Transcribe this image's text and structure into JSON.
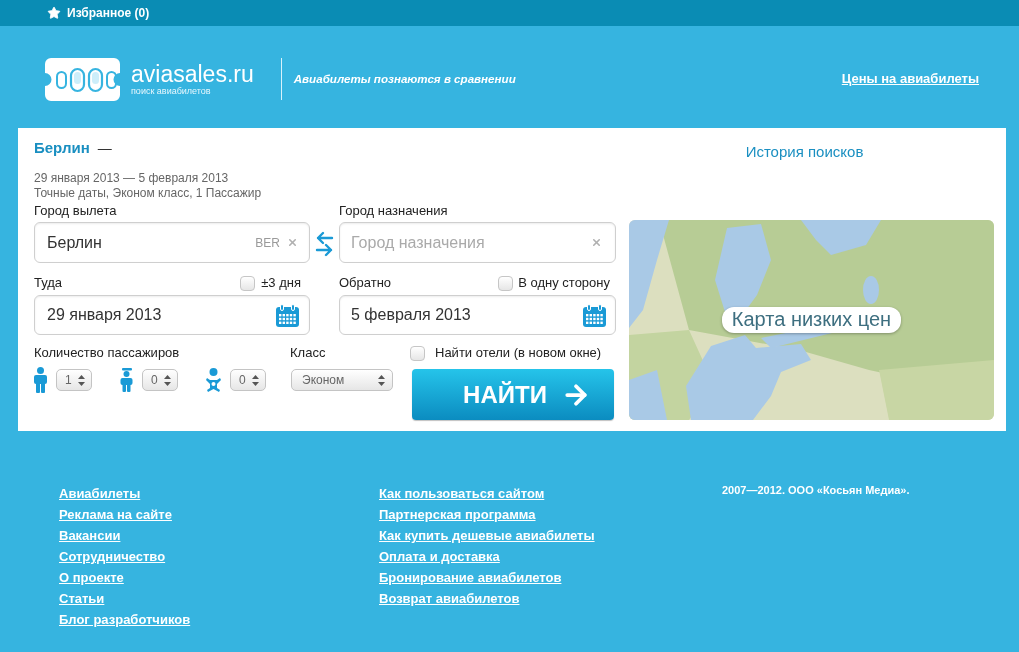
{
  "top_bar": {
    "favorites": "Избранное (0)"
  },
  "header": {
    "logo_text": "aviasales.ru",
    "logo_subtitle": "поиск авиабилетов",
    "tagline": "Авиабилеты познаются в сравнении",
    "prices_link": "Цены на авиабилеты"
  },
  "search": {
    "origin_title": "Берлин",
    "separator": "—",
    "history_link": "История поисков",
    "dates_summary": "29 января 2013 — 5 февраля 2013",
    "options_summary": "Точные даты, Эконом класс, 1 Пассажир",
    "origin_field": {
      "label": "Город вылета",
      "value": "Берлин",
      "code": "BER"
    },
    "destination_field": {
      "label": "Город назначения",
      "placeholder": "Город назначения"
    },
    "depart": {
      "label": "Туда",
      "value": "29 января 2013",
      "option": {
        "label": "±3 дня",
        "checked": false
      }
    },
    "return": {
      "label": "Обратно",
      "value": "5 февраля 2013",
      "option": {
        "label": "В одну сторону",
        "checked": false
      }
    },
    "passengers": {
      "label": "Количество пассажиров",
      "items": [
        {
          "kind": "adult",
          "value": "1"
        },
        {
          "kind": "child",
          "value": "0"
        },
        {
          "kind": "infant",
          "value": "0"
        }
      ]
    },
    "class": {
      "label": "Класс",
      "value": "Эконом"
    },
    "hotels": {
      "label": "Найти отели (в новом окне)",
      "checked": false
    },
    "search_button": "НАЙТИ"
  },
  "map": {
    "label": "Карта низких цен"
  },
  "footer": {
    "columns": [
      [
        "Авиабилеты",
        "Реклама на сайте",
        "Вакансии",
        "Сотрудничество",
        "О проекте",
        "Статьи",
        "Блог разработчиков"
      ],
      [
        "Как пользоваться сайтом",
        "Партнерская программа",
        "Как купить дешевые авиабилеты",
        "Оплата и доставка",
        "Бронирование авиабилетов",
        "Возврат авиабилетов"
      ]
    ],
    "copyright": "2007—2012. ООО «Косьян Медиа»."
  }
}
